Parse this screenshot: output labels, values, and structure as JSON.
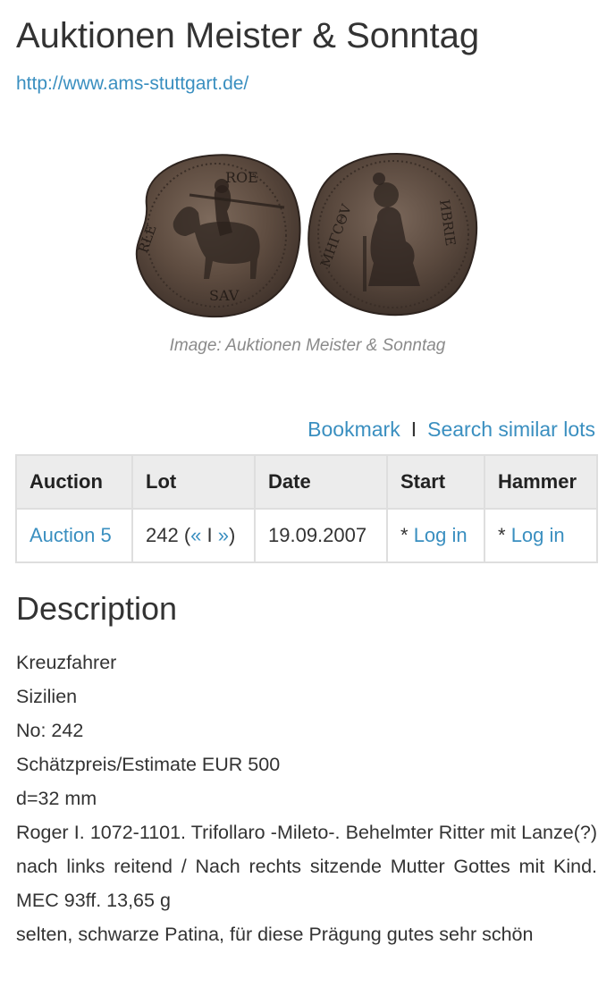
{
  "header": {
    "title": "Auktionen Meister & Sonntag",
    "url": "http://www.ams-stuttgart.de/"
  },
  "image": {
    "caption": "Image: Auktionen Meister & Sonntag",
    "obverse_legend_top": "ROE",
    "obverse_legend_left": "RLE",
    "obverse_legend_bottom": "SAV",
    "reverse_legend_left": "MHΓCΘV",
    "reverse_legend_right": "ИBRIE"
  },
  "actions": {
    "bookmark": "Bookmark",
    "separator": "I",
    "search_similar": "Search similar lots"
  },
  "table": {
    "headers": [
      "Auction",
      "Lot",
      "Date",
      "Start",
      "Hammer"
    ],
    "row": {
      "auction": "Auction 5",
      "lot_number": "242",
      "lot_open": " (",
      "prev": "«",
      "lot_sep": " I ",
      "next": "»",
      "lot_close": ")",
      "date": "19.09.2007",
      "start_prefix": "* ",
      "start_link": "Log in",
      "hammer_prefix": "* ",
      "hammer_link": "Log in"
    }
  },
  "description": {
    "heading": "Description",
    "lines": [
      "Kreuzfahrer",
      "Sizilien",
      "No: 242",
      "Schätzpreis/Estimate EUR 500",
      "d=32 mm",
      "Roger I. 1072-1101. Trifollaro -Mileto-. Behelmter Ritter mit Lanze(?) nach links reitend / Nach rechts sitzende Mutter Gottes mit Kind. MEC 93ff. 13,65 g",
      "selten, schwarze Patina, für diese Prägung gutes sehr schön"
    ]
  },
  "colors": {
    "link": "#3a8fc0",
    "text": "#333333",
    "table_header_bg": "#ececec",
    "table_border": "#dedede",
    "caption": "#8a8a8a",
    "coin_bronze": "#5b4a3e"
  }
}
